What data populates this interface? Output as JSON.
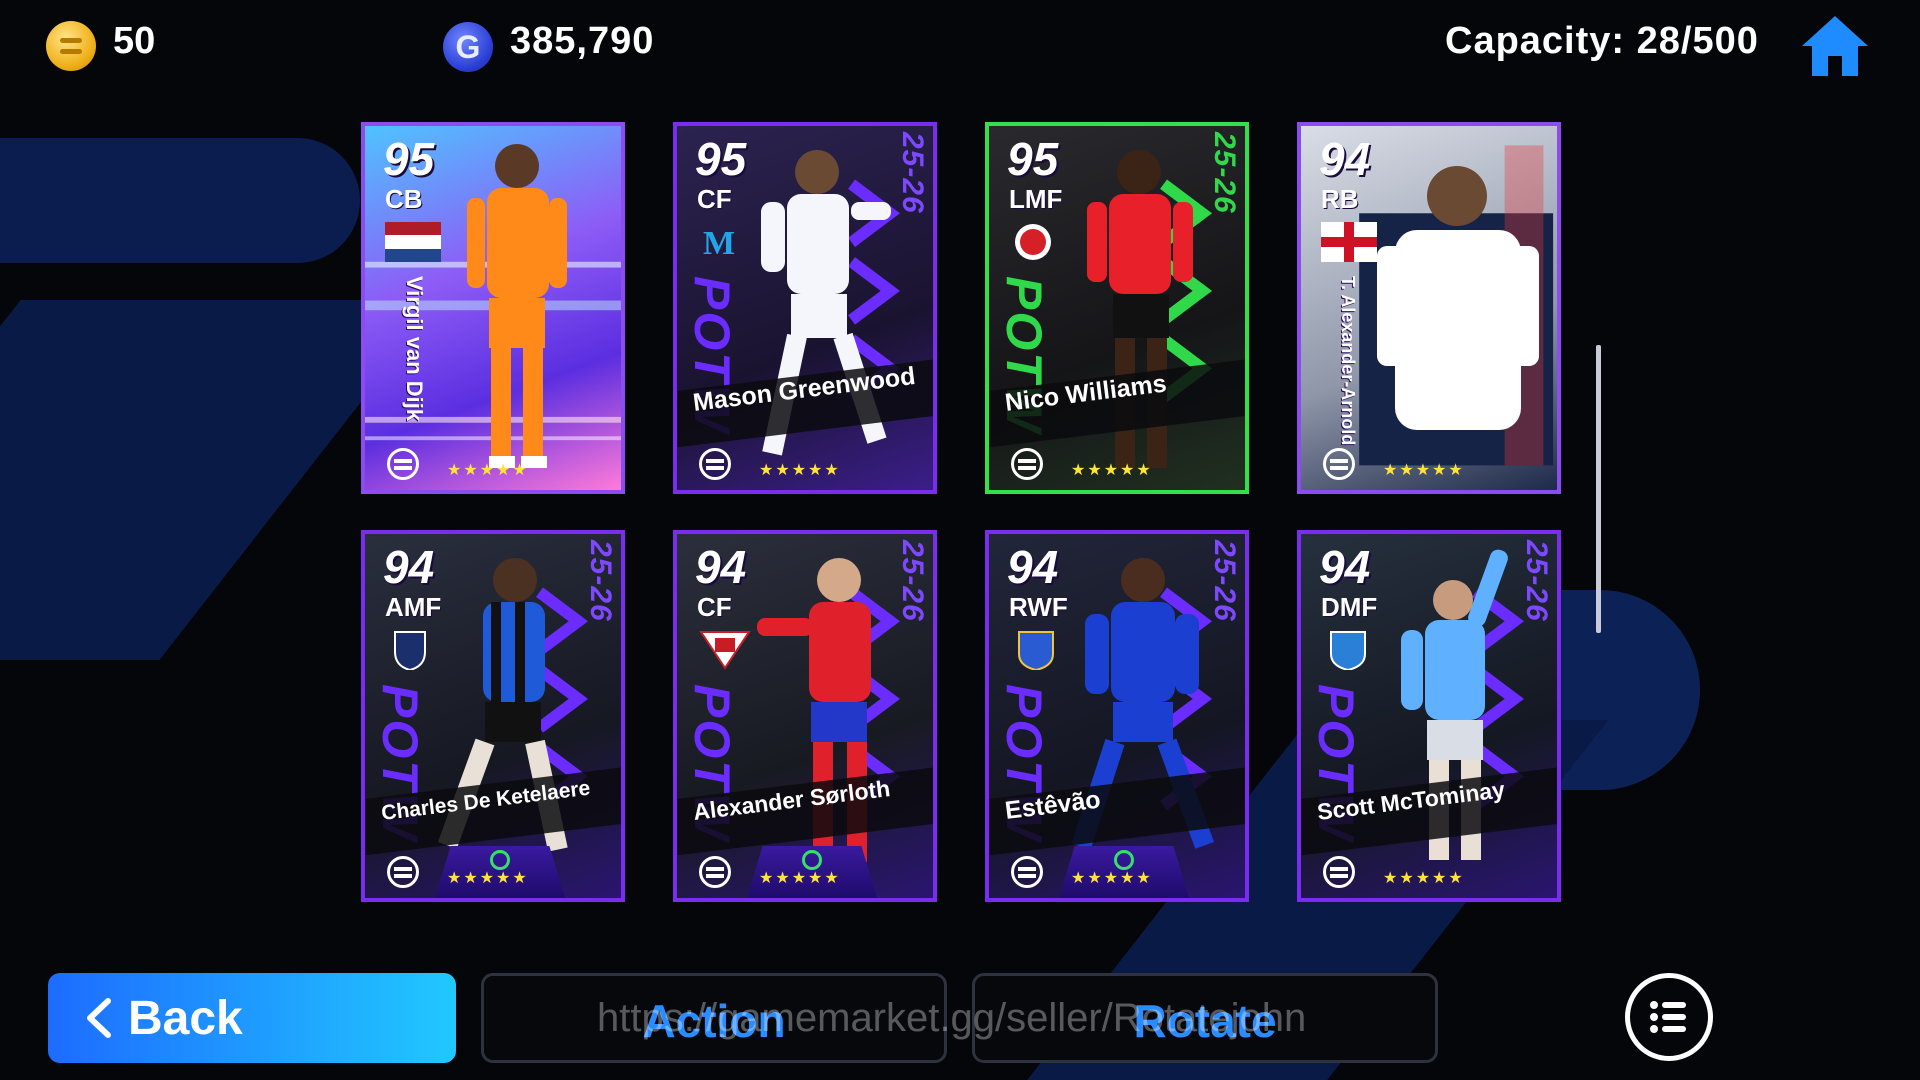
{
  "topbar": {
    "coins": "50",
    "gp": "385,790",
    "gp_symbol": "G",
    "capacity": "Capacity: 28/500",
    "home_icon": "home-icon",
    "accent": "#1e8cff"
  },
  "cards": [
    {
      "rating": "95",
      "position": "CB",
      "name": "Virgil van Dijk",
      "stars": "★★★★★",
      "badge": "netherlands-flag",
      "primary": "#ff8a1a",
      "season": "",
      "potw": ""
    },
    {
      "rating": "95",
      "position": "CF",
      "name": "Mason Greenwood",
      "stars": "★★★★★",
      "badge": "club-crest",
      "primary": "#f4f6fb",
      "season": "25-26",
      "potw": "POTW"
    },
    {
      "rating": "95",
      "position": "LMF",
      "name": "Nico Williams",
      "stars": "★★★★★",
      "badge": "club-crest",
      "primary": "#e8202a",
      "season": "25-26",
      "potw": "POTW"
    },
    {
      "rating": "94",
      "position": "RB",
      "name": "T. Alexander-Arnold",
      "stars": "★★★★★",
      "badge": "england-flag",
      "primary": "#ffffff",
      "season": "",
      "potw": ""
    },
    {
      "rating": "94",
      "position": "AMF",
      "name": "Charles De Ketelaere",
      "stars": "★★★★★",
      "badge": "club-crest",
      "primary": "#1f5ad9",
      "season": "25-26",
      "potw": "POTW"
    },
    {
      "rating": "94",
      "position": "CF",
      "name": "Alexander Sørloth",
      "stars": "★★★★★",
      "badge": "club-crest",
      "primary": "#e0202a",
      "season": "25-26",
      "potw": "POTW"
    },
    {
      "rating": "94",
      "position": "RWF",
      "name": "Estêvão",
      "stars": "★★★★★",
      "badge": "club-crest",
      "primary": "#1b3fd0",
      "season": "25-26",
      "potw": "POTW"
    },
    {
      "rating": "94",
      "position": "DMF",
      "name": "Scott McTominay",
      "stars": "★★★★★",
      "badge": "club-crest",
      "primary": "#5fb0ff",
      "season": "25-26",
      "potw": "POTW"
    }
  ],
  "buttons": {
    "back": "Back",
    "action": "Action",
    "rotate": "Rotate",
    "menu_icon": "list-menu-icon"
  },
  "watermark": "https://gamemarket.gg/seller/Rotatejohn"
}
